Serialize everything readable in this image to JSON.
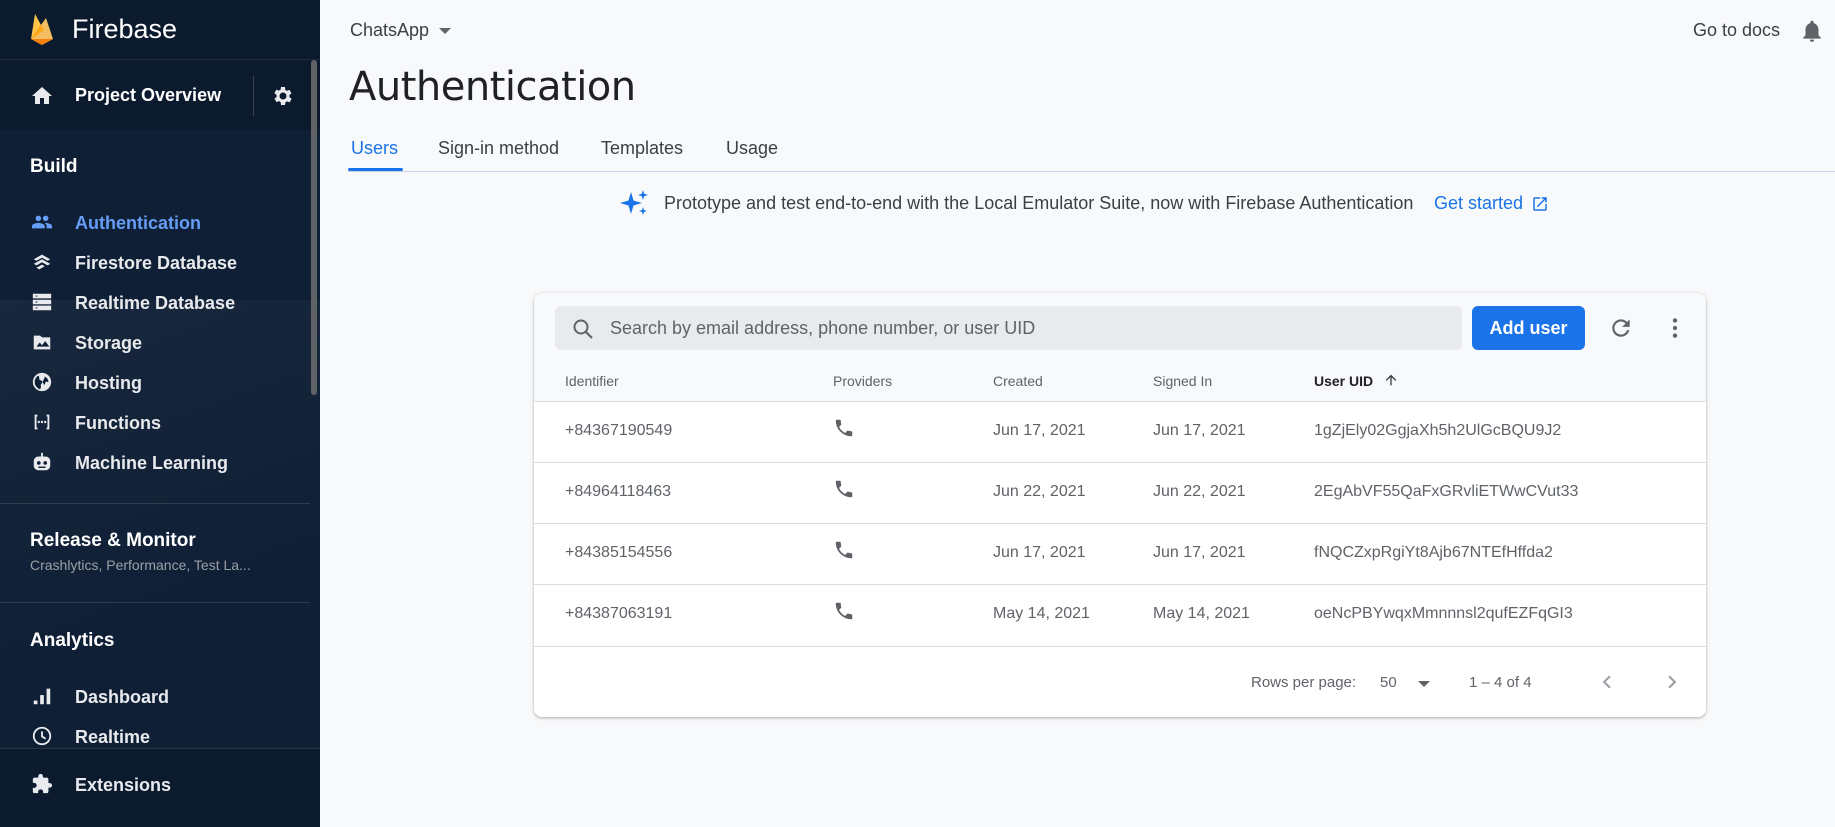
{
  "sidebar": {
    "brand": "Firebase",
    "project_overview": "Project Overview",
    "build_title": "Build",
    "build_items": [
      {
        "label": "Authentication",
        "icon": "people-icon",
        "active": true
      },
      {
        "label": "Firestore Database",
        "icon": "firestore-icon"
      },
      {
        "label": "Realtime Database",
        "icon": "database-icon"
      },
      {
        "label": "Storage",
        "icon": "storage-icon"
      },
      {
        "label": "Hosting",
        "icon": "globe-icon"
      },
      {
        "label": "Functions",
        "icon": "functions-icon"
      },
      {
        "label": "Machine Learning",
        "icon": "robot-icon"
      }
    ],
    "release_title": "Release & Monitor",
    "release_sub": "Crashlytics, Performance, Test La...",
    "analytics_title": "Analytics",
    "analytics_items": [
      {
        "label": "Dashboard",
        "icon": "bar-chart-icon"
      },
      {
        "label": "Realtime",
        "icon": "clock-icon"
      }
    ],
    "extensions": "Extensions"
  },
  "topbar": {
    "project": "ChatsApp",
    "docs": "Go to docs"
  },
  "page": {
    "title": "Authentication",
    "tabs": [
      "Users",
      "Sign-in method",
      "Templates",
      "Usage"
    ],
    "active_tab": "Users",
    "banner_text": "Prototype and test end-to-end with the Local Emulator Suite, now with Firebase Authentication",
    "banner_link": "Get started"
  },
  "users": {
    "search_placeholder": "Search by email address, phone number, or user UID",
    "add_user": "Add user",
    "columns": [
      "Identifier",
      "Providers",
      "Created",
      "Signed In",
      "User UID"
    ],
    "sorted_column": "User UID",
    "rows": [
      {
        "identifier": "+84367190549",
        "provider": "phone-icon",
        "created": "Jun 17, 2021",
        "signed_in": "Jun 17, 2021",
        "uid": "1gZjEly02GgjaXh5h2UlGcBQU9J2"
      },
      {
        "identifier": "+84964118463",
        "provider": "phone-icon",
        "created": "Jun 22, 2021",
        "signed_in": "Jun 22, 2021",
        "uid": "2EgAbVF55QaFxGRvliETWwCVut33"
      },
      {
        "identifier": "+84385154556",
        "provider": "phone-icon",
        "created": "Jun 17, 2021",
        "signed_in": "Jun 17, 2021",
        "uid": "fNQCZxpRgiYt8Ajb67NTEfHffda2"
      },
      {
        "identifier": "+84387063191",
        "provider": "phone-icon",
        "created": "May 14, 2021",
        "signed_in": "May 14, 2021",
        "uid": "oeNcPBYwqxMmnnnsl2qufEZFqGI3"
      }
    ],
    "rows_per_page_label": "Rows per page:",
    "rows_per_page": "50",
    "range": "1 – 4 of 4"
  },
  "colors": {
    "sidebar_bg": "#0f1f35",
    "accent": "#1a73e8",
    "active_nav": "#669df6"
  }
}
